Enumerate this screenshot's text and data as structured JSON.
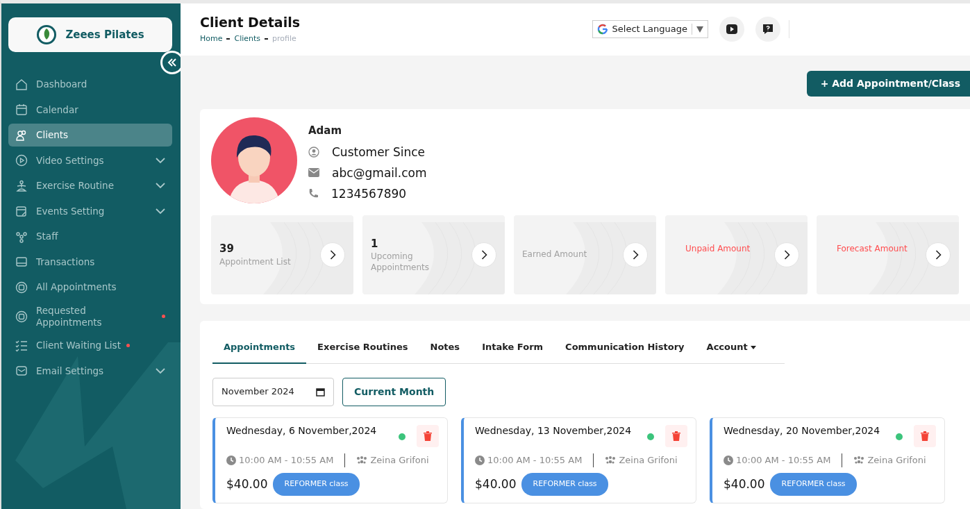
{
  "brand": {
    "name": "Zeees Pilates"
  },
  "sidebar": {
    "items": [
      {
        "label": "Dashboard",
        "selected": false,
        "submenu": false,
        "dot": false
      },
      {
        "label": "Calendar",
        "selected": false,
        "submenu": false,
        "dot": false
      },
      {
        "label": "Clients",
        "selected": true,
        "submenu": false,
        "dot": false
      },
      {
        "label": "Video Settings",
        "selected": false,
        "submenu": true,
        "dot": false
      },
      {
        "label": "Exercise Routine",
        "selected": false,
        "submenu": true,
        "dot": false
      },
      {
        "label": "Events Setting",
        "selected": false,
        "submenu": true,
        "dot": false
      },
      {
        "label": "Staff",
        "selected": false,
        "submenu": false,
        "dot": false
      },
      {
        "label": "Transactions",
        "selected": false,
        "submenu": false,
        "dot": false
      },
      {
        "label": "All Appointments",
        "selected": false,
        "submenu": false,
        "dot": false
      },
      {
        "label": "Requested Appointments",
        "selected": false,
        "submenu": false,
        "dot": true
      },
      {
        "label": "Client Waiting List",
        "selected": false,
        "submenu": false,
        "dot": true
      },
      {
        "label": "Email Settings",
        "selected": false,
        "submenu": true,
        "dot": false
      }
    ]
  },
  "header": {
    "title": "Client Details",
    "breadcrumb": [
      {
        "label": "Home",
        "current": false
      },
      {
        "label": "Clients",
        "current": false
      },
      {
        "label": "profile",
        "current": true
      }
    ],
    "language": "Select Language"
  },
  "add_button": "+ Add Appointment/Class",
  "client": {
    "name": "Adam",
    "since": "Customer Since",
    "email": "abc@gmail.com",
    "phone": "1234567890"
  },
  "stats": [
    {
      "value": "39",
      "label": "Appointment List",
      "alert": false
    },
    {
      "value": "1",
      "label": "Upcoming Appointments",
      "alert": false
    },
    {
      "label": "Earned Amount",
      "alert": false
    },
    {
      "label": "Unpaid Amount",
      "alert": true
    },
    {
      "label": "Forecast Amount",
      "alert": true
    }
  ],
  "tabs": [
    {
      "label": "Appointments",
      "selected": true,
      "dropdown": false
    },
    {
      "label": "Exercise Routines",
      "selected": false,
      "dropdown": false
    },
    {
      "label": "Notes",
      "selected": false,
      "dropdown": false
    },
    {
      "label": "Intake Form",
      "selected": false,
      "dropdown": false
    },
    {
      "label": "Communication History",
      "selected": false,
      "dropdown": false
    },
    {
      "label": "Account",
      "selected": false,
      "dropdown": true
    }
  ],
  "filter": {
    "month": "November 2024",
    "button": "Current Month"
  },
  "appointments": [
    {
      "date": "Wednesday, 6 November,2024",
      "color": "#3cc47c",
      "time": "10:00 AM - 10:55 AM",
      "staff": "Zeina Grifoni",
      "price": "$40.00",
      "class": "REFORMER class"
    },
    {
      "date": "Wednesday, 13 November,2024",
      "color": "#3cc47c",
      "time": "10:00 AM - 10:55 AM",
      "staff": "Zeina Grifoni",
      "price": "$40.00",
      "class": "REFORMER class"
    },
    {
      "date": "Wednesday, 20 November,2024",
      "color": "#3cc47c",
      "time": "10:00 AM - 10:55 AM",
      "staff": "Zeina Grifoni",
      "price": "$40.00",
      "class": "REFORMER class"
    }
  ]
}
